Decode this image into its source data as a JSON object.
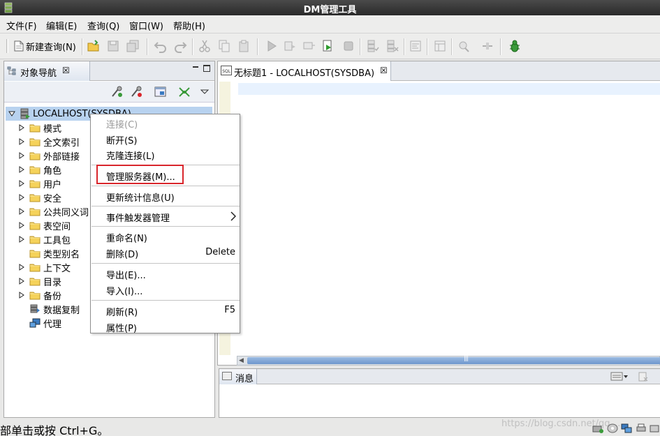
{
  "window": {
    "title": "DM管理工具"
  },
  "menubar": {
    "items": [
      "文件(F)",
      "编辑(E)",
      "查询(Q)",
      "窗口(W)",
      "帮助(H)"
    ]
  },
  "toolbar": {
    "new_query_label": "新建查询(N)",
    "icons": [
      "open-folder-icon",
      "save-icon",
      "save-all-icon",
      "undo-icon",
      "redo-icon",
      "cut-icon",
      "copy-icon",
      "paste-icon",
      "execute-icon",
      "explain-icon",
      "stop-icon",
      "debug-bug-icon"
    ]
  },
  "navigator": {
    "tab_label": "对象导航",
    "tab_close": "☒",
    "root": "LOCALHOST(SYSDBA)",
    "nodes": [
      {
        "label": "模式",
        "expandable": true
      },
      {
        "label": "全文索引",
        "expandable": true
      },
      {
        "label": "外部链接",
        "expandable": true
      },
      {
        "label": "角色",
        "expandable": true
      },
      {
        "label": "用户",
        "expandable": true
      },
      {
        "label": "安全",
        "expandable": true
      },
      {
        "label": "公共同义词",
        "expandable": true
      },
      {
        "label": "表空间",
        "expandable": true
      },
      {
        "label": "工具包",
        "expandable": true
      },
      {
        "label": "类型别名",
        "expandable": false
      },
      {
        "label": "上下文",
        "expandable": true
      },
      {
        "label": "目录",
        "expandable": true
      },
      {
        "label": "备份",
        "expandable": true
      },
      {
        "label": "数据复制",
        "expandable": false
      },
      {
        "label": "代理",
        "expandable": false
      }
    ]
  },
  "editor": {
    "tab_label": "无标题1 - LOCALHOST(SYSDBA)",
    "tab_close": "☒",
    "tab_icon_text": "SQL",
    "scroll_grip": "|||"
  },
  "messages": {
    "tab_label": "消息"
  },
  "context_menu": {
    "items": [
      {
        "label": "连接(C)",
        "accel": "",
        "disabled": true
      },
      {
        "label": "断开(S)",
        "accel": "",
        "disabled": false
      },
      {
        "label": "克隆连接(L)",
        "accel": "",
        "disabled": false
      },
      {
        "label": "管理服务器(M)...",
        "accel": "",
        "disabled": false
      },
      {
        "label": "更新统计信息(U)",
        "accel": "",
        "disabled": false
      },
      {
        "label": "事件触发器管理",
        "accel": "",
        "disabled": false
      },
      {
        "label": "重命名(N)",
        "accel": "",
        "disabled": false
      },
      {
        "label": "删除(D)",
        "accel": "Delete",
        "disabled": false
      },
      {
        "label": "导出(E)...",
        "accel": "",
        "disabled": false
      },
      {
        "label": "导入(I)...",
        "accel": "",
        "disabled": false
      },
      {
        "label": "刷新(R)",
        "accel": "F5",
        "disabled": false
      },
      {
        "label": "属性(P)",
        "accel": "",
        "disabled": false
      }
    ],
    "highlight_color": "#d9262c"
  },
  "statusbar": {
    "text": "部单击或按 Ctrl+G。",
    "watermark": "https://blog.csdn.net/qq_..."
  },
  "colors": {
    "selection": "#b8d2ef",
    "current_line": "#e8f2fe",
    "tab_gradient_end": "#dfe6f0"
  }
}
